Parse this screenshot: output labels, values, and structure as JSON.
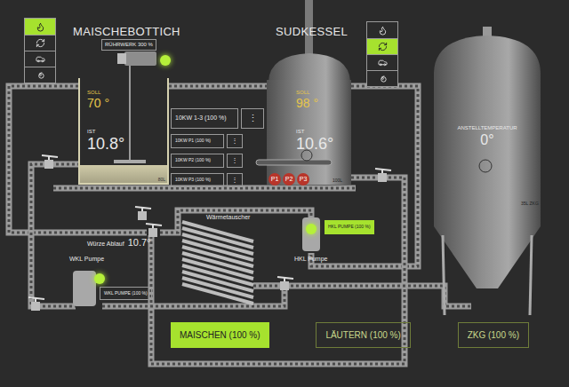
{
  "mash_tun": {
    "title": "MAISCHEBOTTICH",
    "soll_label": "SOLL",
    "soll": "70 °",
    "ist_label": "IST",
    "ist": "10.8°",
    "capacity": "80L",
    "modes": [
      {
        "kind": "heat",
        "selected": true
      },
      {
        "kind": "circulate",
        "selected": false
      },
      {
        "kind": "car",
        "selected": false
      },
      {
        "kind": "spiral",
        "selected": false
      }
    ],
    "stirrer": {
      "label": "RÜHRWERK 300 %",
      "on": true
    }
  },
  "heaters": [
    {
      "label": "10KW 1-3 (100 %)",
      "menu": "⋮",
      "kind": "group"
    },
    {
      "label": "10KW P1 (100 %)",
      "menu": "⋮",
      "kind": "single"
    },
    {
      "label": "10KW P2 (100 %)",
      "menu": "⋮",
      "kind": "single"
    },
    {
      "label": "10KW P3 (100 %)",
      "menu": "⋮",
      "kind": "single"
    }
  ],
  "kettle": {
    "title": "SUDKESSEL",
    "soll_label": "SOLL",
    "soll": "98 °",
    "ist_label": "IST",
    "ist": "10.6°",
    "capacity": "100L",
    "elements": [
      {
        "label": "P1",
        "on": true
      },
      {
        "label": "P2",
        "on": true
      },
      {
        "label": "P3",
        "on": true
      }
    ],
    "modes": [
      {
        "kind": "heat",
        "selected": false
      },
      {
        "kind": "circulate",
        "selected": true
      },
      {
        "kind": "car",
        "selected": false
      },
      {
        "kind": "spiral",
        "selected": false
      }
    ]
  },
  "heat_exchanger": {
    "label": "Wärmetauscher"
  },
  "wort_outlet": {
    "label": "Würze Ablauf",
    "value": "10.7°"
  },
  "pumps": [
    {
      "name": "HKL Pumpe",
      "button": "HKL PUMPE (100 %)",
      "on": true
    },
    {
      "name": "WKL Pumpe",
      "button": "WKL PUMPE (100 %)",
      "on": true
    }
  ],
  "fermenter": {
    "label": "ANSTELLTEMPERATUR",
    "value": "0°",
    "capacity": "35L ZKG"
  },
  "steps": [
    {
      "label": "MAISCHEN (100 %)",
      "selected": true
    },
    {
      "label": "LÄUTERN (100 %)",
      "selected": false
    },
    {
      "label": "ZKG (100 %)",
      "selected": false
    }
  ]
}
